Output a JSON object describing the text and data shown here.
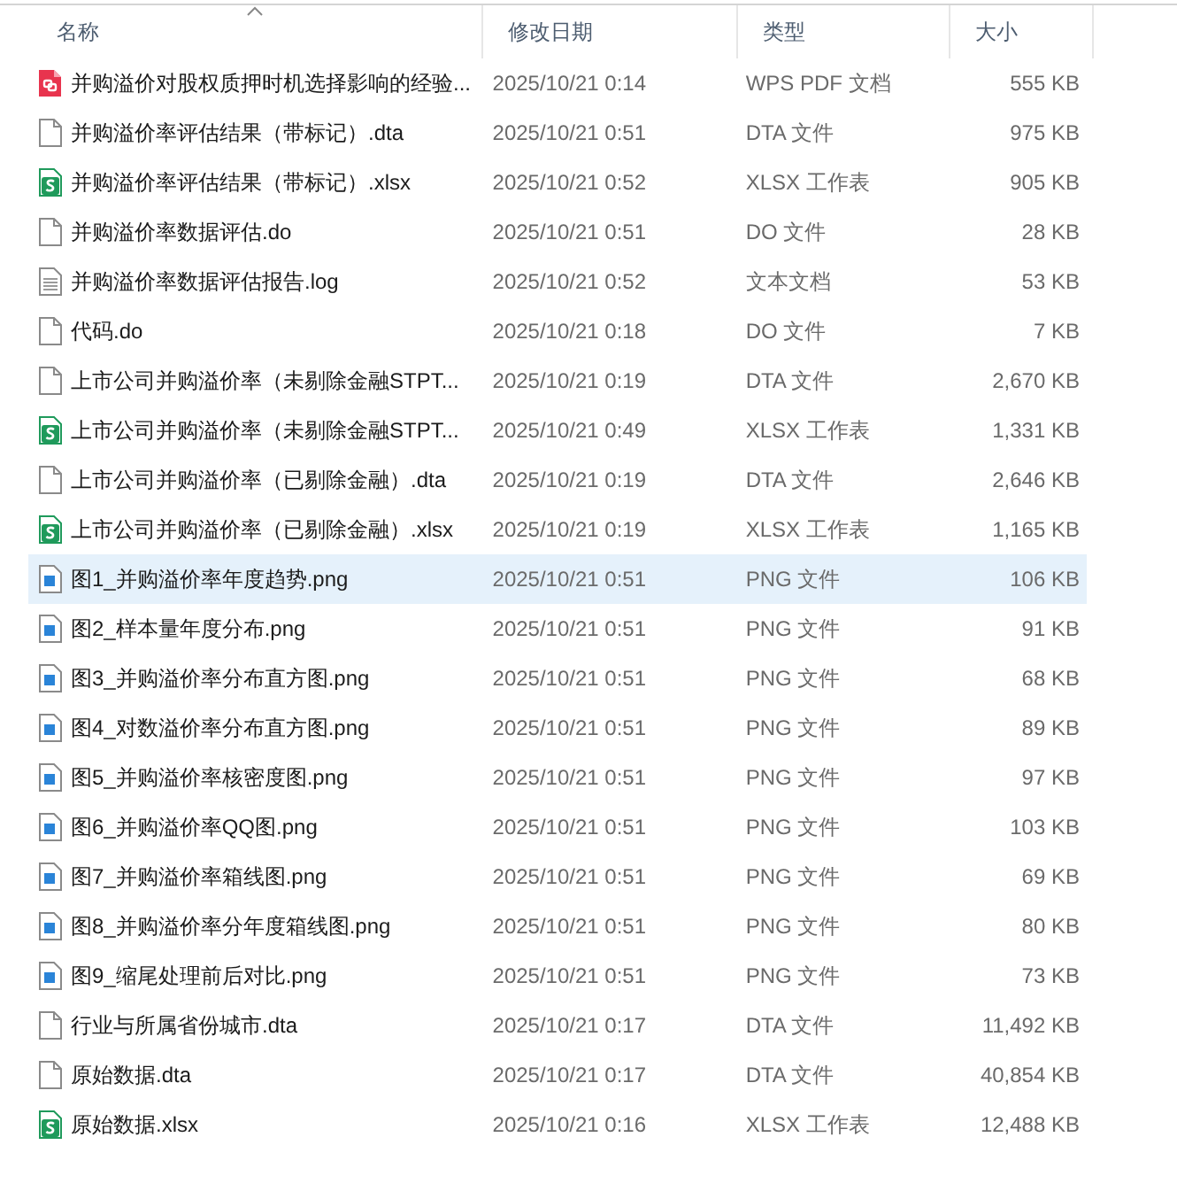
{
  "columns": [
    {
      "label": "名称",
      "sorted": true
    },
    {
      "label": "修改日期",
      "sorted": false
    },
    {
      "label": "类型",
      "sorted": false
    },
    {
      "label": "大小",
      "sorted": false
    }
  ],
  "rows": [
    {
      "kind": "pdf",
      "name": "并购溢价对股权质押时机选择影响的经验...",
      "date": "2025/10/21 0:14",
      "type": "WPS PDF 文档",
      "size": "555 KB",
      "selected": false
    },
    {
      "kind": "blank",
      "name": "并购溢价率评估结果（带标记）.dta",
      "date": "2025/10/21 0:51",
      "type": "DTA 文件",
      "size": "975 KB",
      "selected": false
    },
    {
      "kind": "sheet",
      "name": "并购溢价率评估结果（带标记）.xlsx",
      "date": "2025/10/21 0:52",
      "type": "XLSX 工作表",
      "size": "905 KB",
      "selected": false
    },
    {
      "kind": "blank",
      "name": "并购溢价率数据评估.do",
      "date": "2025/10/21 0:51",
      "type": "DO 文件",
      "size": "28 KB",
      "selected": false
    },
    {
      "kind": "text",
      "name": "并购溢价率数据评估报告.log",
      "date": "2025/10/21 0:52",
      "type": "文本文档",
      "size": "53 KB",
      "selected": false
    },
    {
      "kind": "blank",
      "name": "代码.do",
      "date": "2025/10/21 0:18",
      "type": "DO 文件",
      "size": "7 KB",
      "selected": false
    },
    {
      "kind": "blank",
      "name": "上市公司并购溢价率（未剔除金融STPT...",
      "date": "2025/10/21 0:19",
      "type": "DTA 文件",
      "size": "2,670 KB",
      "selected": false
    },
    {
      "kind": "sheet",
      "name": "上市公司并购溢价率（未剔除金融STPT...",
      "date": "2025/10/21 0:49",
      "type": "XLSX 工作表",
      "size": "1,331 KB",
      "selected": false
    },
    {
      "kind": "blank",
      "name": "上市公司并购溢价率（已剔除金融）.dta",
      "date": "2025/10/21 0:19",
      "type": "DTA 文件",
      "size": "2,646 KB",
      "selected": false
    },
    {
      "kind": "sheet",
      "name": "上市公司并购溢价率（已剔除金融）.xlsx",
      "date": "2025/10/21 0:19",
      "type": "XLSX 工作表",
      "size": "1,165 KB",
      "selected": false
    },
    {
      "kind": "image",
      "name": "图1_并购溢价率年度趋势.png",
      "date": "2025/10/21 0:51",
      "type": "PNG 文件",
      "size": "106 KB",
      "selected": true
    },
    {
      "kind": "image",
      "name": "图2_样本量年度分布.png",
      "date": "2025/10/21 0:51",
      "type": "PNG 文件",
      "size": "91 KB",
      "selected": false
    },
    {
      "kind": "image",
      "name": "图3_并购溢价率分布直方图.png",
      "date": "2025/10/21 0:51",
      "type": "PNG 文件",
      "size": "68 KB",
      "selected": false
    },
    {
      "kind": "image",
      "name": "图4_对数溢价率分布直方图.png",
      "date": "2025/10/21 0:51",
      "type": "PNG 文件",
      "size": "89 KB",
      "selected": false
    },
    {
      "kind": "image",
      "name": "图5_并购溢价率核密度图.png",
      "date": "2025/10/21 0:51",
      "type": "PNG 文件",
      "size": "97 KB",
      "selected": false
    },
    {
      "kind": "image",
      "name": "图6_并购溢价率QQ图.png",
      "date": "2025/10/21 0:51",
      "type": "PNG 文件",
      "size": "103 KB",
      "selected": false
    },
    {
      "kind": "image",
      "name": "图7_并购溢价率箱线图.png",
      "date": "2025/10/21 0:51",
      "type": "PNG 文件",
      "size": "69 KB",
      "selected": false
    },
    {
      "kind": "image",
      "name": "图8_并购溢价率分年度箱线图.png",
      "date": "2025/10/21 0:51",
      "type": "PNG 文件",
      "size": "80 KB",
      "selected": false
    },
    {
      "kind": "image",
      "name": "图9_缩尾处理前后对比.png",
      "date": "2025/10/21 0:51",
      "type": "PNG 文件",
      "size": "73 KB",
      "selected": false
    },
    {
      "kind": "blank",
      "name": "行业与所属省份城市.dta",
      "date": "2025/10/21 0:17",
      "type": "DTA 文件",
      "size": "11,492 KB",
      "selected": false
    },
    {
      "kind": "blank",
      "name": "原始数据.dta",
      "date": "2025/10/21 0:17",
      "type": "DTA 文件",
      "size": "40,854 KB",
      "selected": false
    },
    {
      "kind": "sheet",
      "name": "原始数据.xlsx",
      "date": "2025/10/21 0:16",
      "type": "XLSX 工作表",
      "size": "12,488 KB",
      "selected": false
    }
  ]
}
